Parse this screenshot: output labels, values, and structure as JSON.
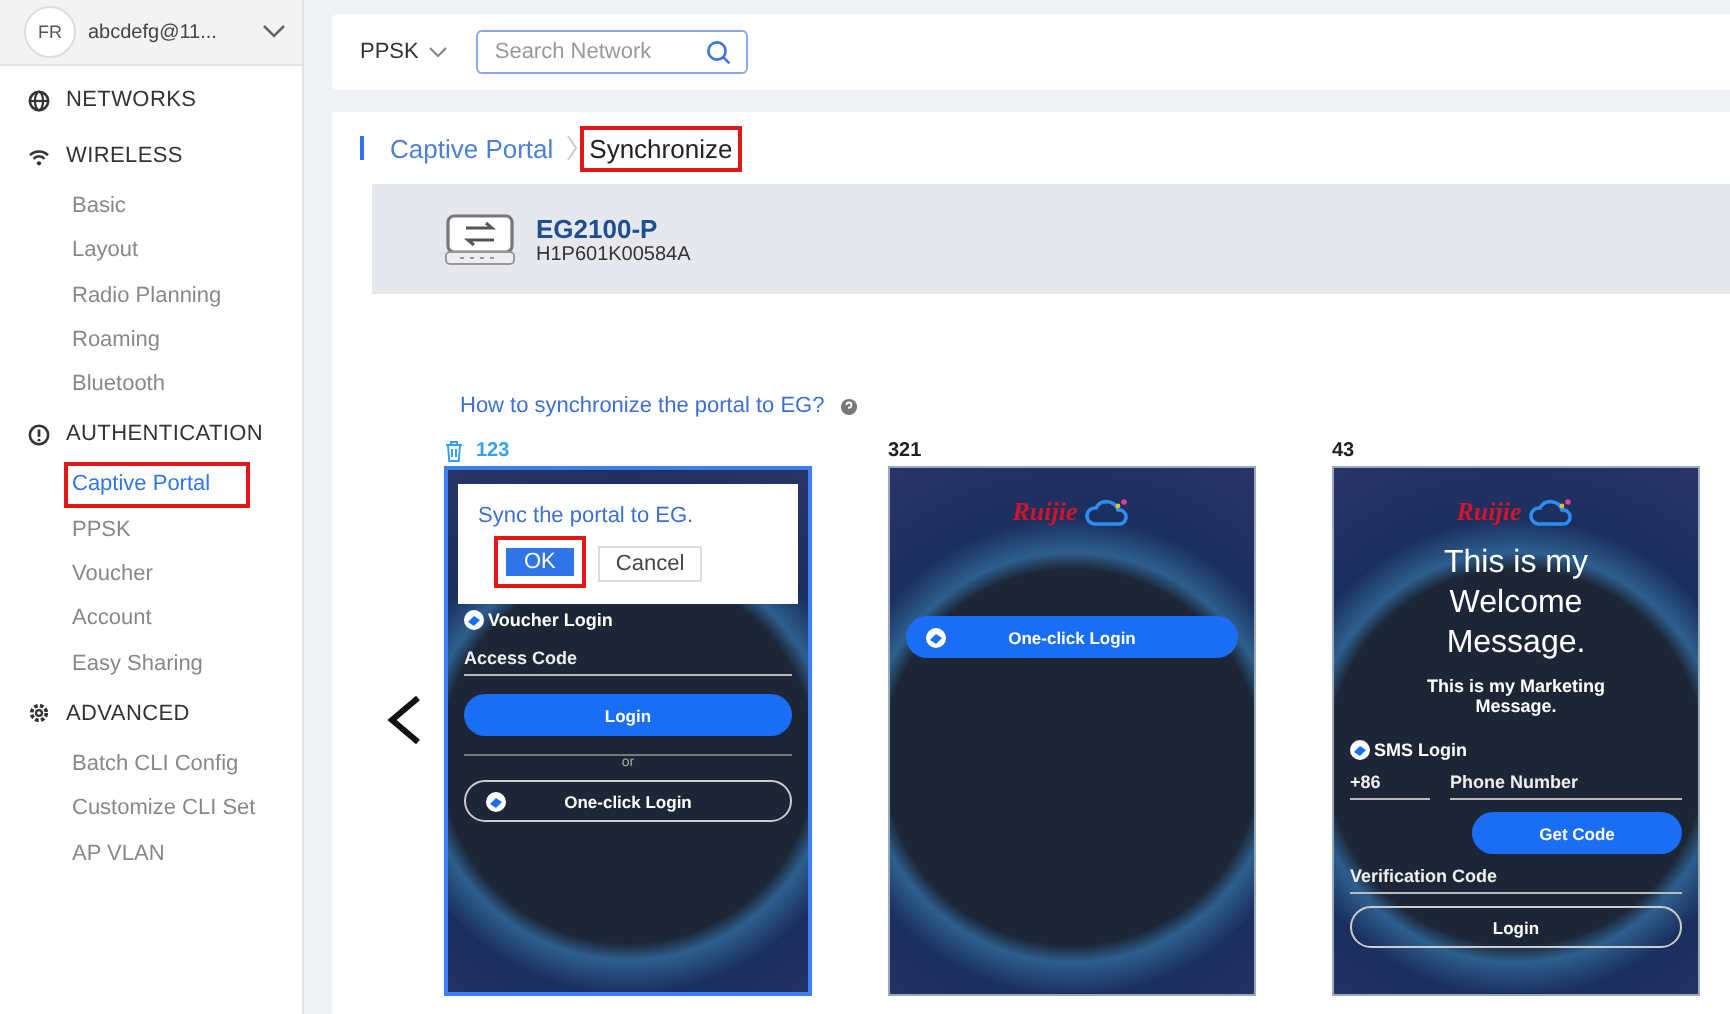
{
  "account": {
    "avatar": "FR",
    "name": "abcdefg@11..."
  },
  "sidebar": {
    "sections": [
      {
        "kind": "networks",
        "label": "NETWORKS"
      },
      {
        "kind": "wireless",
        "label": "WIRELESS",
        "children": [
          {
            "label": "Basic",
            "selected": false,
            "highlighted": false
          },
          {
            "label": "Layout",
            "selected": false,
            "highlighted": false
          },
          {
            "label": "Radio Planning",
            "selected": false,
            "highlighted": false
          },
          {
            "label": "Roaming",
            "selected": false,
            "highlighted": false
          },
          {
            "label": "Bluetooth",
            "selected": false,
            "highlighted": false
          }
        ]
      },
      {
        "kind": "authentication",
        "label": "AUTHENTICATION",
        "children": [
          {
            "label": "Captive Portal",
            "selected": true,
            "highlighted": true
          },
          {
            "label": "PPSK",
            "selected": false,
            "highlighted": false
          },
          {
            "label": "Voucher",
            "selected": false,
            "highlighted": false
          },
          {
            "label": "Account",
            "selected": false,
            "highlighted": false
          },
          {
            "label": "Easy Sharing",
            "selected": false,
            "highlighted": false
          }
        ]
      },
      {
        "kind": "advanced",
        "label": "ADVANCED",
        "children": [
          {
            "label": "Batch CLI Config",
            "selected": false,
            "highlighted": false
          },
          {
            "label": "Customize CLI Set",
            "selected": false,
            "highlighted": false
          },
          {
            "label": "AP VLAN",
            "selected": false,
            "highlighted": false
          }
        ]
      }
    ]
  },
  "toolbar": {
    "network": "PPSK",
    "search": {
      "placeholder": "Search Network"
    }
  },
  "breadcrumb": [
    {
      "label": "Captive Portal",
      "selected": false,
      "highlighted": false
    },
    {
      "label": "Synchronize",
      "selected": true,
      "highlighted": true
    }
  ],
  "device": {
    "name": "EG2100-P",
    "serial": "H1P601K00584A"
  },
  "help_link": "How to synchronize the portal to EG?",
  "portals": [
    {
      "name": "123",
      "selected": true,
      "popup": {
        "message": "Sync the portal to EG.",
        "buttons": [
          {
            "label": "OK",
            "kind": "primary",
            "highlighted": true
          },
          {
            "label": "Cancel",
            "kind": "default",
            "highlighted": false
          }
        ]
      },
      "elements": [
        {
          "kind": "label",
          "text": "Voucher Login"
        },
        {
          "kind": "field",
          "placeholder": "Access Code"
        },
        {
          "kind": "primary",
          "text": "Login"
        },
        {
          "kind": "divider",
          "text": "or"
        },
        {
          "kind": "outline",
          "text": "One-click Login",
          "icon": true
        }
      ]
    },
    {
      "name": "321",
      "selected": false,
      "elements": [
        {
          "kind": "logo",
          "text": "Ruijie"
        },
        {
          "kind": "primary",
          "text": "One-click Login",
          "icon": true
        }
      ]
    },
    {
      "name": "43",
      "selected": false,
      "elements": [
        {
          "kind": "logo",
          "text": "Ruijie"
        },
        {
          "kind": "heading",
          "text": "This is my Welcome Message."
        },
        {
          "kind": "note",
          "text": "This is my Marketing Message."
        },
        {
          "kind": "label",
          "text": "SMS Login"
        },
        {
          "kind": "phone",
          "code": "+86",
          "placeholder": "Phone Number"
        },
        {
          "kind": "code_button",
          "text": "Get Code"
        },
        {
          "kind": "field",
          "placeholder": "Verification Code"
        },
        {
          "kind": "outline",
          "text": "Login",
          "icon": false
        }
      ]
    }
  ]
}
